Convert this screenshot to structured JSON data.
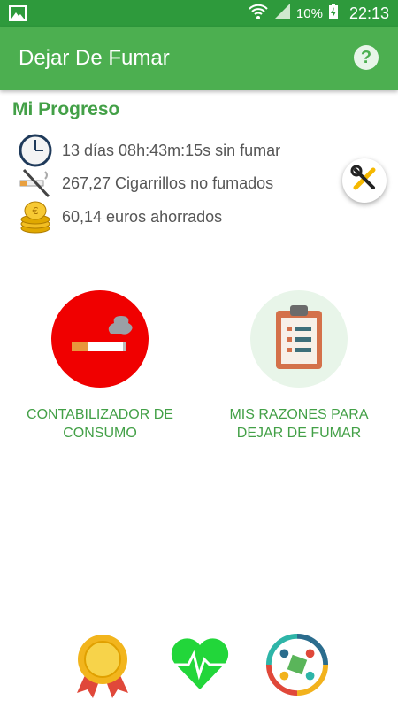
{
  "status_bar": {
    "battery": "10%",
    "time": "22:13",
    "icons": [
      "image-icon",
      "wifi-icon",
      "signal-icon",
      "battery-charging-icon"
    ]
  },
  "app_bar": {
    "title": "Dejar De Fumar",
    "help_icon": "help-icon"
  },
  "progress": {
    "title": "Mi Progreso",
    "items": [
      {
        "icon": "clock-icon",
        "text": "13 días 08h:43m:15s sin fumar"
      },
      {
        "icon": "no-smoking-icon",
        "text": "267,27 Cigarrillos no fumados"
      },
      {
        "icon": "coins-icon",
        "text": "60,14 euros ahorrados"
      }
    ],
    "settings_icon": "tools-icon"
  },
  "features": [
    {
      "icon": "cigarette-icon",
      "label": "CONTABILIZADOR DE CONSUMO"
    },
    {
      "icon": "clipboard-icon",
      "label": "MIS RAZONES PARA DEJAR DE FUMAR"
    }
  ],
  "bottom_nav": [
    "medal-icon",
    "heart-pulse-icon",
    "community-icon"
  ],
  "colors": {
    "primary": "#4caf50",
    "primary_dark": "#2e9a3c",
    "accent_text": "#43a047",
    "cigarette_circle": "#f00000",
    "clipboard_circle": "#e8f5e9"
  }
}
